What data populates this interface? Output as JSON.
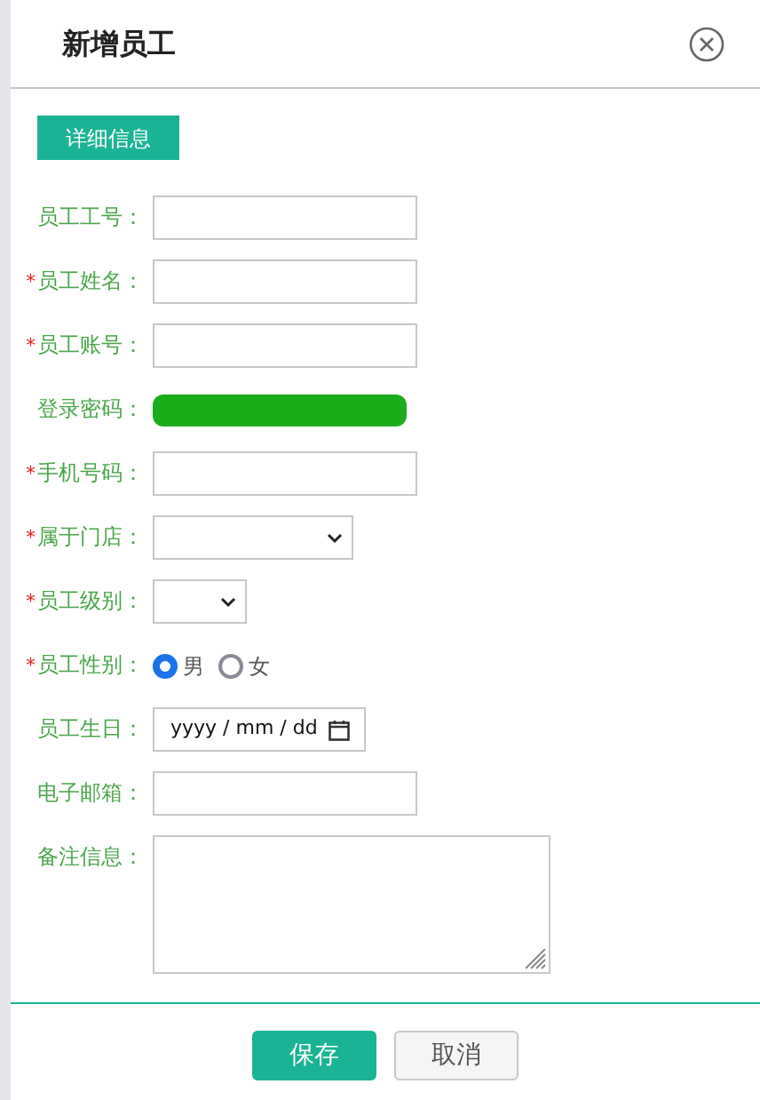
{
  "dialog": {
    "title": "新增员工"
  },
  "required_mark": "*",
  "tabs": [
    {
      "label": "详细信息",
      "selected": true
    }
  ],
  "fields": [
    {
      "label": "员工工号：",
      "required": false,
      "kind": "text"
    },
    {
      "label": "员工姓名：",
      "required": true,
      "kind": "text"
    },
    {
      "label": "员工账号：",
      "required": true,
      "kind": "text"
    },
    {
      "label": "登录密码：",
      "required": false,
      "kind": "redacted"
    },
    {
      "label": "手机号码：",
      "required": true,
      "kind": "text"
    },
    {
      "label": "属于门店：",
      "required": true,
      "kind": "select"
    },
    {
      "label": "员工级别：",
      "required": true,
      "kind": "short_select"
    },
    {
      "label": "员工性别：",
      "required": true,
      "kind": "radio",
      "options": [
        {
          "label": "男",
          "selected": true
        },
        {
          "label": "女",
          "selected": false
        }
      ]
    },
    {
      "label": "员工生日：",
      "required": false,
      "kind": "date",
      "placeholder": "yyyy / mm / dd"
    },
    {
      "label": "电子邮箱：",
      "required": false,
      "kind": "text"
    },
    {
      "label": "备注信息：",
      "required": false,
      "kind": "textarea"
    }
  ],
  "buttons": [
    {
      "label": "保存",
      "kind": "primary"
    },
    {
      "label": "取消",
      "kind": "secondary"
    }
  ]
}
